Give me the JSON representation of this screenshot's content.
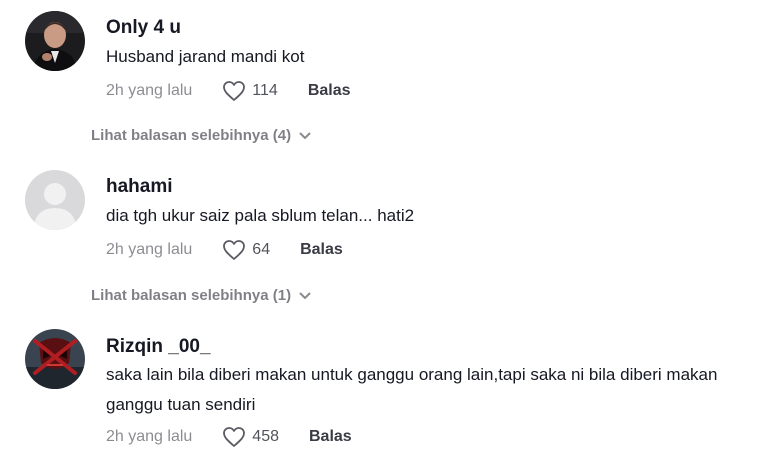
{
  "comments": [
    {
      "username": "Only 4 u",
      "text": "Husband jarand mandi kot",
      "time": "2h yang lalu",
      "likes": "114",
      "reply_label": "Balas",
      "avatar_icon": "user-photo-avatar",
      "more_replies": "Lihat balasan selebihnya (4)"
    },
    {
      "username": "hahami",
      "text": "dia tgh ukur saiz pala sblum telan... hati2",
      "time": "2h yang lalu",
      "likes": "64",
      "reply_label": "Balas",
      "avatar_icon": "default-user-avatar",
      "more_replies": "Lihat balasan selebihnya (1)"
    },
    {
      "username": "Rizqin _00_",
      "text": "saka lain bila diberi makan untuk ganggu orang lain,tapi saka ni bila diberi makan ganggu tuan sendiri",
      "time": "2h yang lalu",
      "likes": "458",
      "reply_label": "Balas",
      "avatar_icon": "mask-avatar"
    }
  ],
  "colors": {
    "text_primary": "#161823",
    "text_secondary": "#8a8b91",
    "default_avatar_bg": "#d9d9db"
  }
}
